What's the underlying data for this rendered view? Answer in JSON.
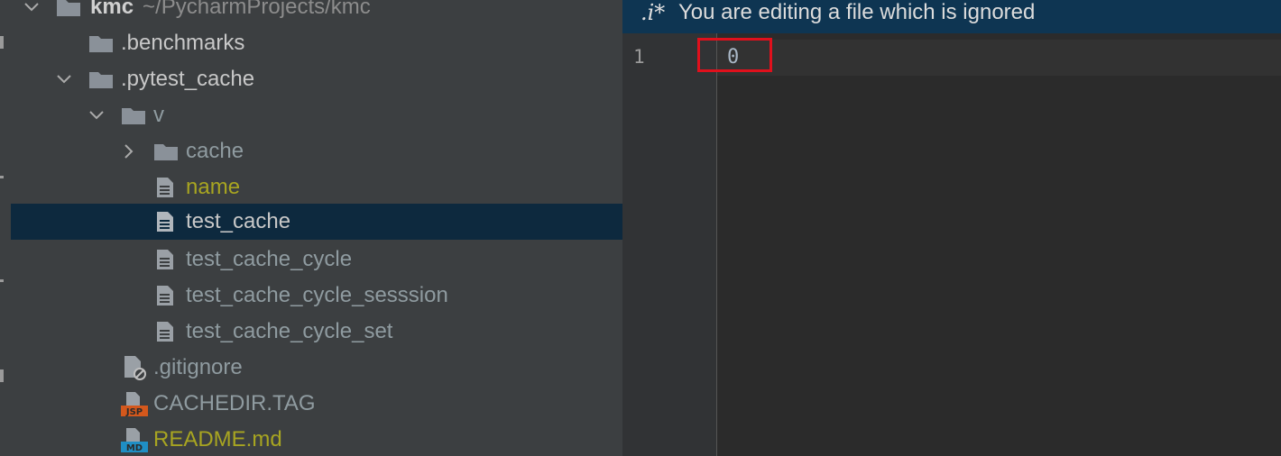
{
  "project_tree": {
    "root": {
      "name": "kmc",
      "path": "~/PycharmProjects/kmc"
    },
    "items": [
      {
        "label": ".benchmarks",
        "type": "folder"
      },
      {
        "label": ".pytest_cache",
        "type": "folder",
        "expanded": true
      },
      {
        "label": "v",
        "type": "folder",
        "expanded": true
      },
      {
        "label": "cache",
        "type": "folder",
        "expanded": false
      },
      {
        "label": "name",
        "type": "file"
      },
      {
        "label": "test_cache",
        "type": "file",
        "selected": true
      },
      {
        "label": "test_cache_cycle",
        "type": "file"
      },
      {
        "label": "test_cache_cycle_sesssion",
        "type": "file"
      },
      {
        "label": "test_cache_cycle_set",
        "type": "file"
      },
      {
        "label": ".gitignore",
        "type": "ignore-file"
      },
      {
        "label": "CACHEDIR.TAG",
        "type": "jsp-file",
        "badge": "JSP"
      },
      {
        "label": "README.md",
        "type": "md-file",
        "badge": "MD"
      }
    ]
  },
  "editor": {
    "banner": {
      "icon": ".i*",
      "text": "You are editing a file which is ignored"
    },
    "line_number": "1",
    "content": "0"
  },
  "colors": {
    "accent_selection": "#0d293e",
    "banner_bg": "#0e3552",
    "highlight": "#e0101c",
    "modified_yellow": "#a8a521"
  }
}
